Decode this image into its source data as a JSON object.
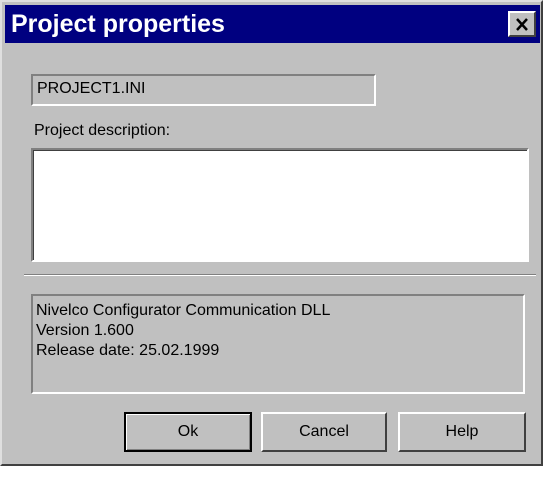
{
  "window": {
    "title": "Project properties",
    "close_symbol": "close-icon"
  },
  "project": {
    "filename": "PROJECT1.INI",
    "description_label": "Project description:",
    "description_value": ""
  },
  "about": {
    "line1": "Nivelco Configurator Communication DLL",
    "line2": "Version 1.600",
    "line3": "Release date: 25.02.1999"
  },
  "buttons": {
    "ok": "Ok",
    "cancel": "Cancel",
    "help": "Help"
  },
  "colors": {
    "titlebar": "#000080",
    "face": "#c0c0c0"
  }
}
